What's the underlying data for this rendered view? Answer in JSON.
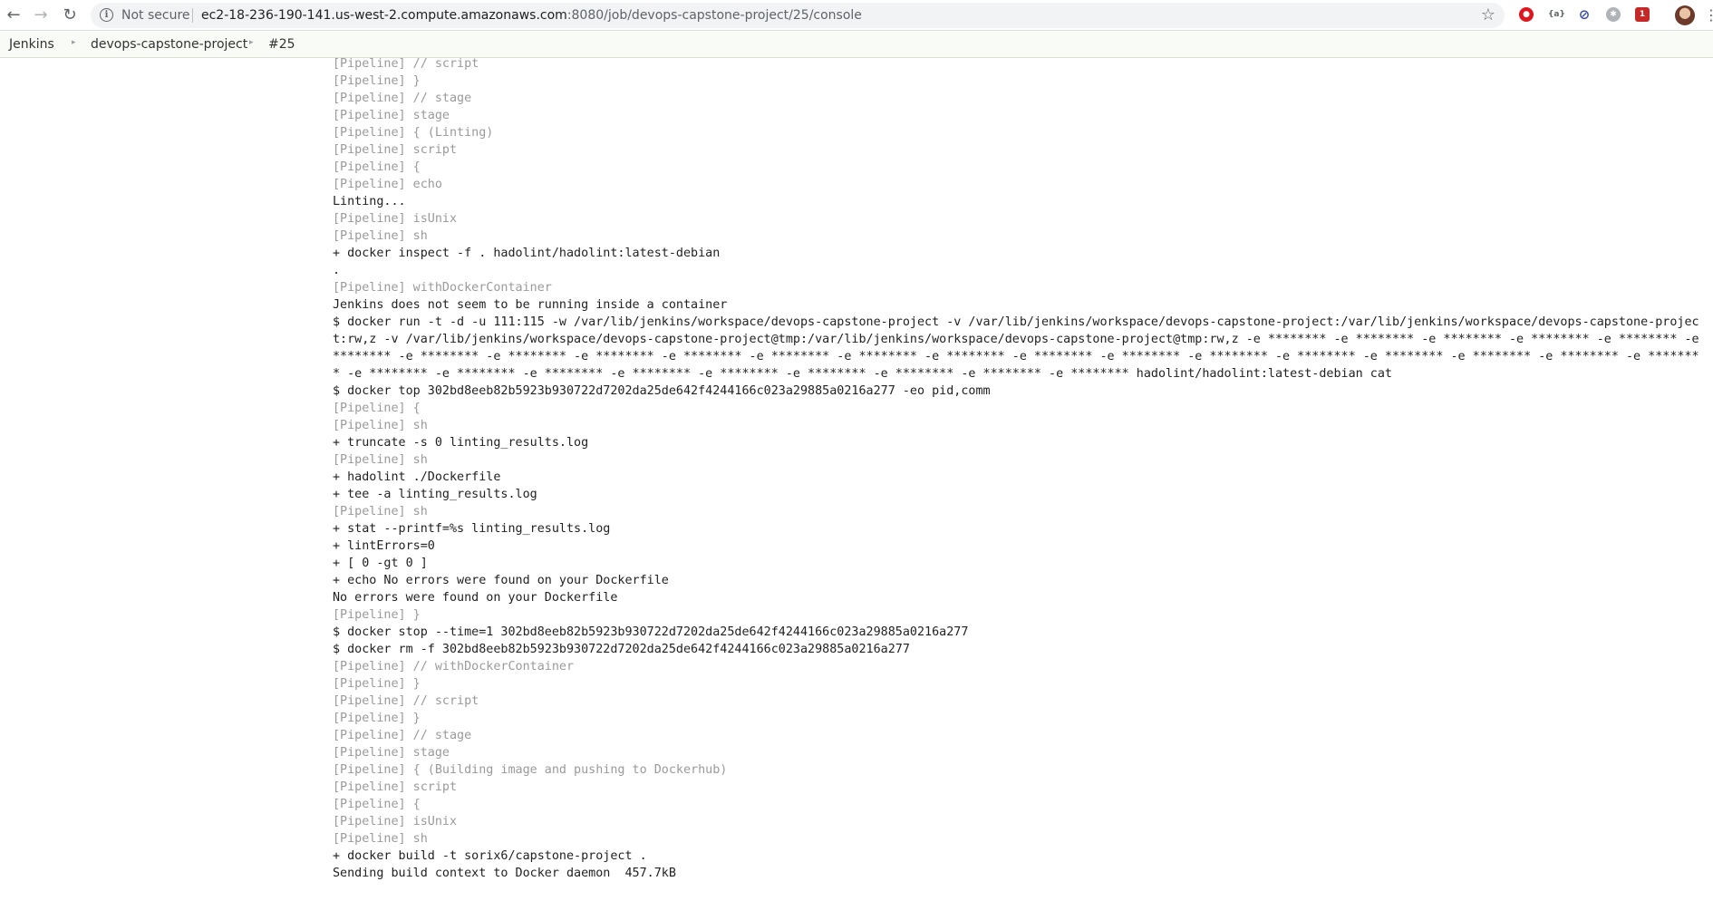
{
  "browser": {
    "security_label": "Not secure",
    "url_host": "ec2-18-236-190-141.us-west-2.compute.amazonaws.com",
    "url_path": ":8080/job/devops-capstone-project/25/console",
    "extensions": [
      {
        "name": "opera-adblock-icon",
        "color": "#e0161e",
        "glyph": "●"
      },
      {
        "name": "json-viewer-icon",
        "color": "#5f6368",
        "glyph": "{a}"
      },
      {
        "name": "block-icon",
        "color": "#3c4fa8",
        "glyph": "⊘"
      },
      {
        "name": "grey-extension-icon",
        "color": "#b0b3b8",
        "glyph": "✱"
      },
      {
        "name": "mail-badge-icon",
        "color": "#c62828",
        "glyph": "1"
      }
    ]
  },
  "breadcrumb": {
    "items": [
      "Jenkins",
      "devops-capstone-project",
      "#25"
    ]
  },
  "console": {
    "lines": [
      {
        "text": "[Pipeline] // script",
        "pipeline": true
      },
      {
        "text": "[Pipeline] }",
        "pipeline": true
      },
      {
        "text": "[Pipeline] // stage",
        "pipeline": true
      },
      {
        "text": "[Pipeline] stage",
        "pipeline": true
      },
      {
        "text": "[Pipeline] { (Linting)",
        "pipeline": true
      },
      {
        "text": "[Pipeline] script",
        "pipeline": true
      },
      {
        "text": "[Pipeline] {",
        "pipeline": true
      },
      {
        "text": "[Pipeline] echo",
        "pipeline": true
      },
      {
        "text": "Linting...",
        "pipeline": false
      },
      {
        "text": "[Pipeline] isUnix",
        "pipeline": true
      },
      {
        "text": "[Pipeline] sh",
        "pipeline": true
      },
      {
        "text": "+ docker inspect -f . hadolint/hadolint:latest-debian",
        "pipeline": false
      },
      {
        "text": ".",
        "pipeline": false
      },
      {
        "text": "[Pipeline] withDockerContainer",
        "pipeline": true
      },
      {
        "text": "Jenkins does not seem to be running inside a container",
        "pipeline": false
      },
      {
        "text": "$ docker run -t -d -u 111:115 -w /var/lib/jenkins/workspace/devops-capstone-project -v /var/lib/jenkins/workspace/devops-capstone-project:/var/lib/jenkins/workspace/devops-capstone-project:rw,z -v /var/lib/jenkins/workspace/devops-capstone-project@tmp:/var/lib/jenkins/workspace/devops-capstone-project@tmp:rw,z -e ******** -e ******** -e ******** -e ******** -e ******** -e ******** -e ******** -e ******** -e ******** -e ******** -e ******** -e ******** -e ******** -e ******** -e ******** -e ******** -e ******** -e ******** -e ******** -e ******** -e ******** -e ******** -e ******** -e ******** -e ******** -e ******** -e ******** -e ******** -e ******** -e ******** hadolint/hadolint:latest-debian cat",
        "pipeline": false,
        "wrap": true
      },
      {
        "text": "$ docker top 302bd8eeb82b5923b930722d7202da25de642f4244166c023a29885a0216a277 -eo pid,comm",
        "pipeline": false
      },
      {
        "text": "[Pipeline] {",
        "pipeline": true
      },
      {
        "text": "[Pipeline] sh",
        "pipeline": true
      },
      {
        "text": "+ truncate -s 0 linting_results.log",
        "pipeline": false
      },
      {
        "text": "[Pipeline] sh",
        "pipeline": true
      },
      {
        "text": "+ hadolint ./Dockerfile",
        "pipeline": false
      },
      {
        "text": "+ tee -a linting_results.log",
        "pipeline": false
      },
      {
        "text": "[Pipeline] sh",
        "pipeline": true
      },
      {
        "text": "+ stat --printf=%s linting_results.log",
        "pipeline": false
      },
      {
        "text": "+ lintErrors=0",
        "pipeline": false
      },
      {
        "text": "+ [ 0 -gt 0 ]",
        "pipeline": false
      },
      {
        "text": "+ echo No errors were found on your Dockerfile",
        "pipeline": false
      },
      {
        "text": "No errors were found on your Dockerfile",
        "pipeline": false
      },
      {
        "text": "[Pipeline] }",
        "pipeline": true
      },
      {
        "text": "$ docker stop --time=1 302bd8eeb82b5923b930722d7202da25de642f4244166c023a29885a0216a277",
        "pipeline": false
      },
      {
        "text": "$ docker rm -f 302bd8eeb82b5923b930722d7202da25de642f4244166c023a29885a0216a277",
        "pipeline": false
      },
      {
        "text": "[Pipeline] // withDockerContainer",
        "pipeline": true
      },
      {
        "text": "[Pipeline] }",
        "pipeline": true
      },
      {
        "text": "[Pipeline] // script",
        "pipeline": true
      },
      {
        "text": "[Pipeline] }",
        "pipeline": true
      },
      {
        "text": "[Pipeline] // stage",
        "pipeline": true
      },
      {
        "text": "[Pipeline] stage",
        "pipeline": true
      },
      {
        "text": "[Pipeline] { (Building image and pushing to Dockerhub)",
        "pipeline": true
      },
      {
        "text": "[Pipeline] script",
        "pipeline": true
      },
      {
        "text": "[Pipeline] {",
        "pipeline": true
      },
      {
        "text": "[Pipeline] isUnix",
        "pipeline": true
      },
      {
        "text": "[Pipeline] sh",
        "pipeline": true
      },
      {
        "text": "+ docker build -t sorix6/capstone-project .",
        "pipeline": false
      },
      {
        "text": "Sending build context to Docker daemon  457.7kB",
        "pipeline": false
      }
    ]
  }
}
